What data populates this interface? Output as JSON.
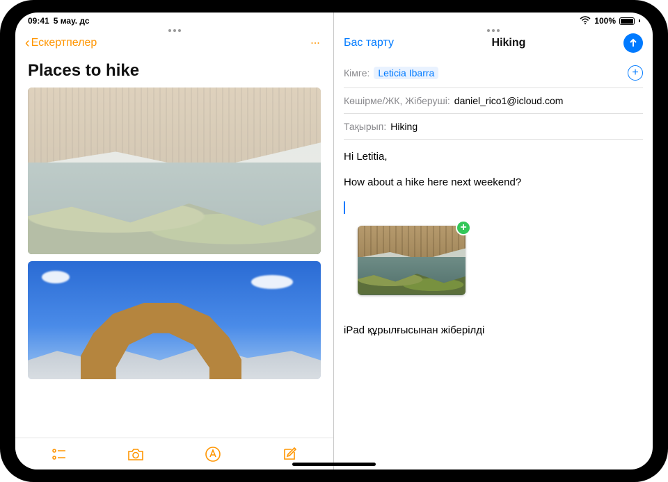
{
  "status": {
    "time": "09:41",
    "date": "5 мау. дс",
    "battery_pct": "100%"
  },
  "notes": {
    "back_label": "Ескертпелер",
    "title": "Places to hike"
  },
  "mail": {
    "cancel": "Бас тарту",
    "title": "Hiking",
    "to_label": "Кімге:",
    "to_recipient": "Leticia Ibarra",
    "cc_label": "Көшірме/ЖК, Жіберуші:",
    "cc_value": "daniel_rico1@icloud.com",
    "subject_label": "Тақырып:",
    "subject_value": "Hiking",
    "body_line1": "Hi Letitia,",
    "body_line2": "How about a hike here next weekend?",
    "signature": "iPad құрылғысынан жіберілді"
  }
}
